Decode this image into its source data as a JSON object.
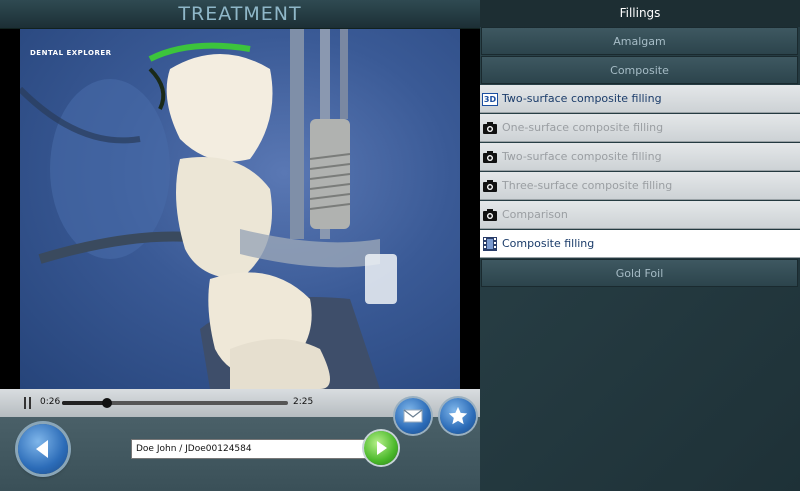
{
  "header": {
    "title": "TREATMENT"
  },
  "video": {
    "brand": "DENTAL EXPLORER",
    "time_current": "0:26",
    "time_total": "2:25",
    "progress": 0.2
  },
  "bottom": {
    "patient_value": "Doe John / JDoe00124584"
  },
  "panel": {
    "title": "Fillings",
    "categories": [
      "Amalgam",
      "Composite",
      "Gold Foil"
    ],
    "items": [
      {
        "label": "Two-surface composite filling",
        "icon": "3d-icon"
      },
      {
        "label": "One-surface composite filling",
        "icon": "camera-icon"
      },
      {
        "label": "Two-surface composite filling",
        "icon": "camera-icon"
      },
      {
        "label": "Three-surface composite filling",
        "icon": "camera-icon"
      },
      {
        "label": "Comparison",
        "icon": "camera-icon"
      },
      {
        "label": "Composite filling",
        "icon": "film-icon"
      }
    ],
    "icon_3d_text": "3D"
  },
  "colors": {
    "accent": "#1b3c6a",
    "header_text": "#8fb7c8"
  }
}
